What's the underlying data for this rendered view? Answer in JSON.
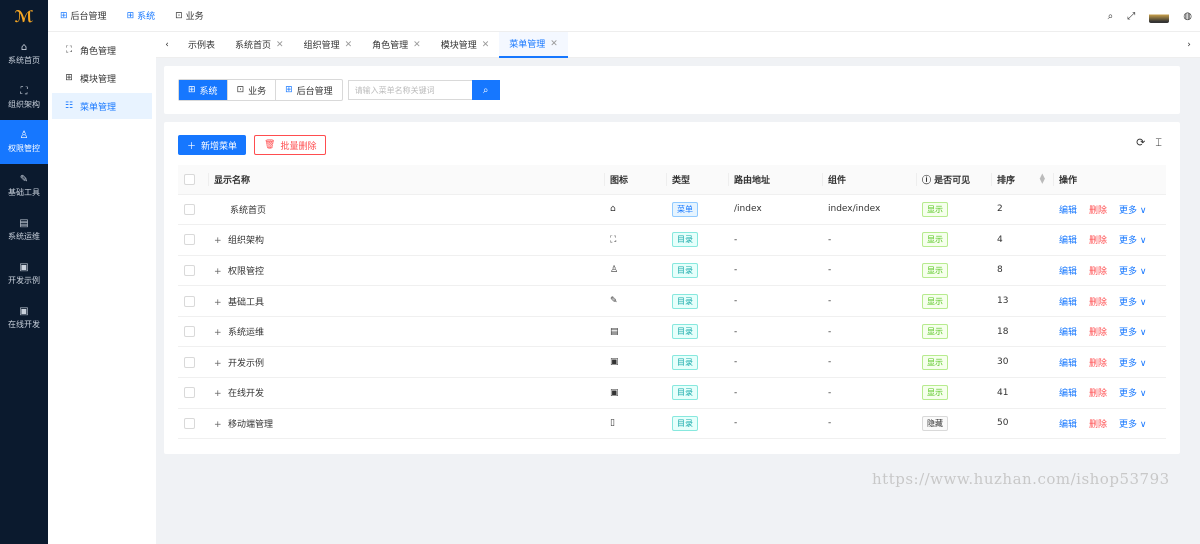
{
  "leftnav": {
    "items": [
      {
        "label": "系统首页",
        "icon": "home-icon",
        "glyph": "⌂"
      },
      {
        "label": "组织架构",
        "icon": "org-icon",
        "glyph": "⛶"
      },
      {
        "label": "权限管控",
        "icon": "user-icon",
        "glyph": "♙"
      },
      {
        "label": "基础工具",
        "icon": "wrench-icon",
        "glyph": "✎"
      },
      {
        "label": "系统运维",
        "icon": "book-icon",
        "glyph": "▤"
      },
      {
        "label": "开发示例",
        "icon": "window-icon",
        "glyph": "▣"
      },
      {
        "label": "在线开发",
        "icon": "window-icon",
        "glyph": "▣"
      }
    ]
  },
  "topbar": {
    "menus": [
      "后台管理",
      "系统",
      "业务"
    ]
  },
  "subnav": {
    "items": [
      "角色管理",
      "模块管理",
      "菜单管理"
    ]
  },
  "tabs": [
    "示例表",
    "系统首页",
    "组织管理",
    "角色管理",
    "模块管理",
    "菜单管理"
  ],
  "filter": {
    "segments": [
      "系统",
      "业务",
      "后台管理"
    ],
    "placeholder": "请输入菜单名称关键词"
  },
  "actions": {
    "add": "新增菜单",
    "batch_delete": "批量删除"
  },
  "table": {
    "headers": [
      "显示名称",
      "图标",
      "类型",
      "路由地址",
      "组件",
      "是否可见",
      "排序",
      "操作"
    ],
    "rows": [
      {
        "name": "系统首页",
        "expandable": false,
        "icon": "⌂",
        "type": "菜单",
        "route": "/index",
        "component": "index/index",
        "visible": "显示",
        "sort": "2"
      },
      {
        "name": "组织架构",
        "expandable": true,
        "icon": "⛶",
        "type": "目录",
        "route": "-",
        "component": "-",
        "visible": "显示",
        "sort": "4"
      },
      {
        "name": "权限管控",
        "expandable": true,
        "icon": "♙",
        "type": "目录",
        "route": "-",
        "component": "-",
        "visible": "显示",
        "sort": "8"
      },
      {
        "name": "基础工具",
        "expandable": true,
        "icon": "✎",
        "type": "目录",
        "route": "-",
        "component": "-",
        "visible": "显示",
        "sort": "13"
      },
      {
        "name": "系统运维",
        "expandable": true,
        "icon": "▤",
        "type": "目录",
        "route": "-",
        "component": "-",
        "visible": "显示",
        "sort": "18"
      },
      {
        "name": "开发示例",
        "expandable": true,
        "icon": "▣",
        "type": "目录",
        "route": "-",
        "component": "-",
        "visible": "显示",
        "sort": "30"
      },
      {
        "name": "在线开发",
        "expandable": true,
        "icon": "▣",
        "type": "目录",
        "route": "-",
        "component": "-",
        "visible": "显示",
        "sort": "41"
      },
      {
        "name": "移动端管理",
        "expandable": true,
        "icon": "▯",
        "type": "目录",
        "route": "-",
        "component": "-",
        "visible": "隐藏",
        "sort": "50"
      }
    ],
    "ops": {
      "edit": "编辑",
      "delete": "删除",
      "more": "更多"
    }
  },
  "watermark": "https://www.huzhan.com/ishop53793"
}
